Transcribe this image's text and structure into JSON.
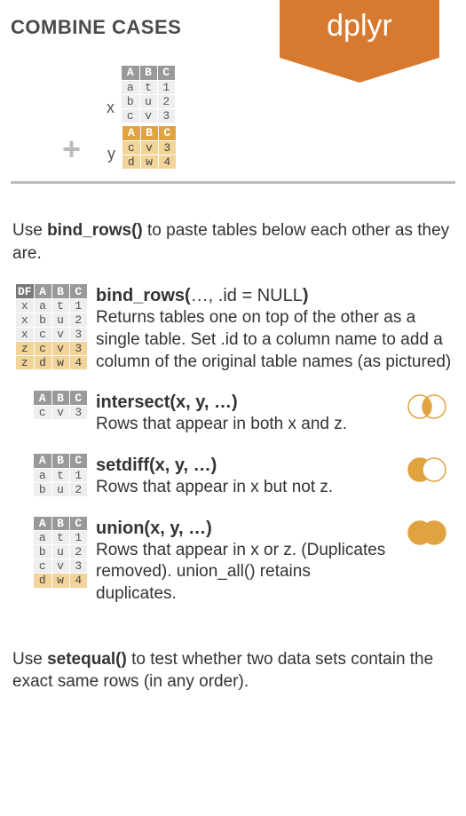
{
  "header": {
    "section_title": "COMBINE CASES",
    "ribbon": "dplyr"
  },
  "example": {
    "x_label": "x",
    "y_label": "y",
    "plus": "+",
    "x_table": {
      "head": [
        "A",
        "B",
        "C"
      ],
      "rows": [
        [
          "a",
          "t",
          "1"
        ],
        [
          "b",
          "u",
          "2"
        ],
        [
          "c",
          "v",
          "3"
        ]
      ]
    },
    "y_table": {
      "head": [
        "A",
        "B",
        "C"
      ],
      "rows": [
        [
          "c",
          "v",
          "3"
        ],
        [
          "d",
          "w",
          "4"
        ]
      ]
    }
  },
  "intro_pre": "Use ",
  "intro_fn": "bind_rows()",
  "intro_post": " to paste tables below each other as they are.",
  "bind_rows": {
    "sig_pre": "bind_rows(",
    "sig_mid": "…, .id = NULL",
    "sig_post": ")",
    "desc": "Returns tables one on top of the other as a single table. Set .id to a column name to add a column of the original table names (as pictured)",
    "table": {
      "head": [
        "DF",
        "A",
        "B",
        "C"
      ],
      "rows": [
        [
          "x",
          "a",
          "t",
          "1"
        ],
        [
          "x",
          "b",
          "u",
          "2"
        ],
        [
          "x",
          "c",
          "v",
          "3"
        ],
        [
          "z",
          "c",
          "v",
          "3"
        ],
        [
          "z",
          "d",
          "w",
          "4"
        ]
      ]
    }
  },
  "intersect": {
    "sig": "intersect(x, y, …)",
    "desc": "Rows that appear in both x and z.",
    "table": {
      "head": [
        "A",
        "B",
        "C"
      ],
      "rows": [
        [
          "c",
          "v",
          "3"
        ]
      ]
    }
  },
  "setdiff": {
    "sig": "setdiff(x, y, …)",
    "desc": "Rows that appear in x but not z.",
    "table": {
      "head": [
        "A",
        "B",
        "C"
      ],
      "rows": [
        [
          "a",
          "t",
          "1"
        ],
        [
          "b",
          "u",
          "2"
        ]
      ]
    }
  },
  "union": {
    "sig": "union(x, y, …)",
    "desc": "Rows that appear in x or z. (Duplicates removed). union_all() retains duplicates.",
    "table": {
      "head": [
        "A",
        "B",
        "C"
      ],
      "rows": [
        [
          "a",
          "t",
          "1"
        ],
        [
          "b",
          "u",
          "2"
        ],
        [
          "c",
          "v",
          "3"
        ],
        [
          "d",
          "w",
          "4"
        ]
      ]
    }
  },
  "outro_pre": "Use ",
  "outro_fn": "setequal()",
  "outro_post": " to test whether two data sets contain the exact same rows (in any order)."
}
